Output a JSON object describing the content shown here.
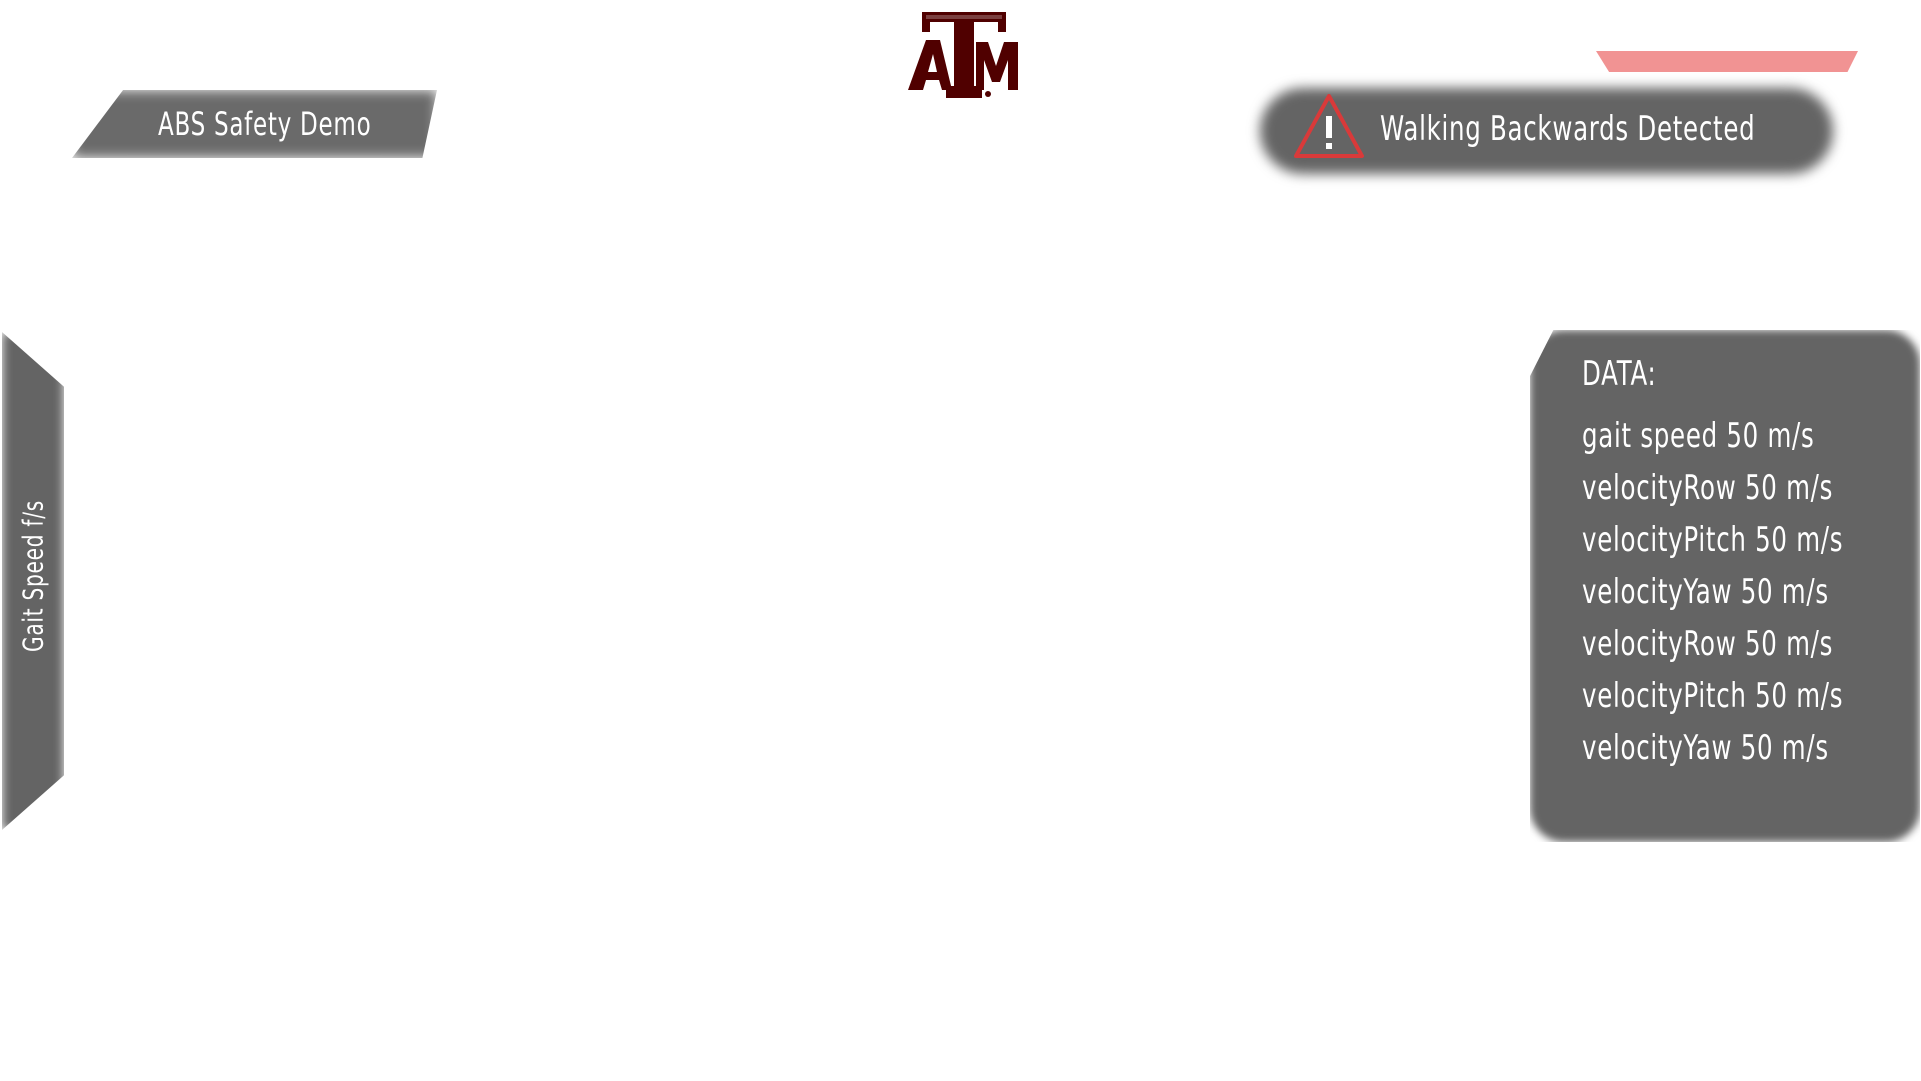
{
  "header": {
    "title": "ABS Safety Demo",
    "logo_name": "ATM"
  },
  "alert": {
    "message": "Walking Backwards Detected",
    "icon": "warning-triangle-icon",
    "icon_color": "#d93a3a"
  },
  "indicator": {
    "color": "#f08a8a"
  },
  "left_panel": {
    "label": "Gait Speed f/s"
  },
  "data_panel": {
    "title": "DATA:",
    "items": [
      {
        "label": "gait speed 50 m/s"
      },
      {
        "label": "velocityRow 50 m/s"
      },
      {
        "label": "velocityPitch 50 m/s"
      },
      {
        "label": "velocityYaw 50 m/s"
      },
      {
        "label": "velocityRow 50 m/s"
      },
      {
        "label": "velocityPitch 50 m/s"
      },
      {
        "label": "velocityYaw 50 m/s"
      }
    ]
  },
  "colors": {
    "panel_bg": "#646464",
    "text": "#ffffff",
    "logo_maroon": "#500000"
  }
}
